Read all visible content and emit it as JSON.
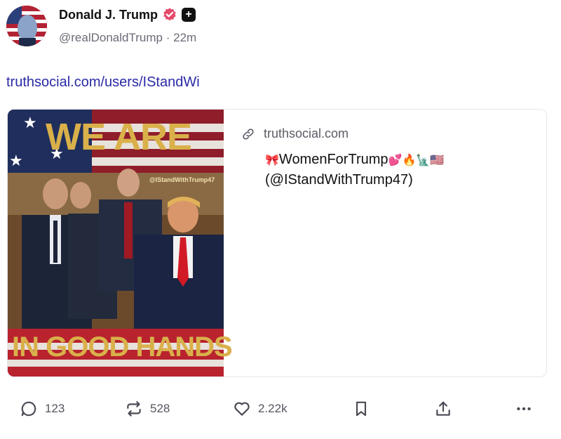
{
  "post": {
    "author_name": "Donald J. Trump",
    "handle": "@realDonaldTrump",
    "separator": "·",
    "time": "22m",
    "link_url": "truthsocial.com/users/IStandWi"
  },
  "card": {
    "domain": "truthsocial.com",
    "title_text": "WomenForTrump",
    "title_handle": "(@IStandWithTrump47)",
    "image_text_top": "WE ARE",
    "image_text_bottom": "IN GOOD HANDS",
    "image_watermark": "@IStandWithTrump47"
  },
  "actions": {
    "reply_count": "123",
    "retruth_count": "528",
    "like_count": "2.22k"
  },
  "icons": {
    "verified": "verified-badge-icon",
    "plus": "plus-badge-icon",
    "link": "link-icon",
    "reply": "comment-icon",
    "retruth": "repost-icon",
    "like": "heart-icon",
    "bookmark": "bookmark-icon",
    "share": "share-icon",
    "more": "more-icon"
  },
  "colors": {
    "link": "#2a2aa6",
    "verified": "#e34b6a",
    "muted": "#6b6b78"
  }
}
